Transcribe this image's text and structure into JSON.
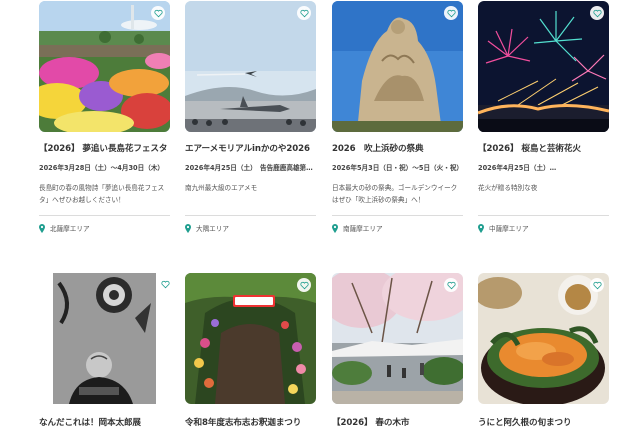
{
  "colors": {
    "accent": "#1f9e8f",
    "title": "#333333",
    "divider": "#dcdcdc"
  },
  "icons": {
    "favorite": "heart-icon",
    "location": "map-pin-icon"
  },
  "row1": [
    {
      "title": "【2026】 夢追い長島花フェスタ",
      "date": "2026年3月28日（土）〜4月30日（木）",
      "desc": "長島町の春の風物詩「夢追い長島花フェスタ」へぜひお越しください！",
      "area": "北薩摩エリア"
    },
    {
      "title": "エアーメモリアルinかのや2026",
      "date": "2026年4月25日（土）　告告鹿鹿高雄第…",
      "desc": "南九州最大級のエアメモ",
      "area": "大隅エリア"
    },
    {
      "title": "2026　吹上浜砂の祭典",
      "date": "2026年5月3日（日・祝）〜5日（火・祝）",
      "desc": "日本最大の砂の祭典。ゴールデンウイークはぜひ「吹上浜砂の祭典」へ！",
      "area": "南薩摩エリア"
    },
    {
      "title": "【2026】 桜島と芸術花火",
      "date": "2026年4月25日（土）…",
      "desc": "花火が贈る特別な夜",
      "area": "中薩摩エリア"
    }
  ],
  "row2": [
    {
      "title": "なんだこれは！岡本太郎展"
    },
    {
      "title": "令和8年度志布志お釈迦まつり"
    },
    {
      "title": "【2026】 春の木市"
    },
    {
      "title": "うにと阿久根の旬まつり"
    }
  ]
}
